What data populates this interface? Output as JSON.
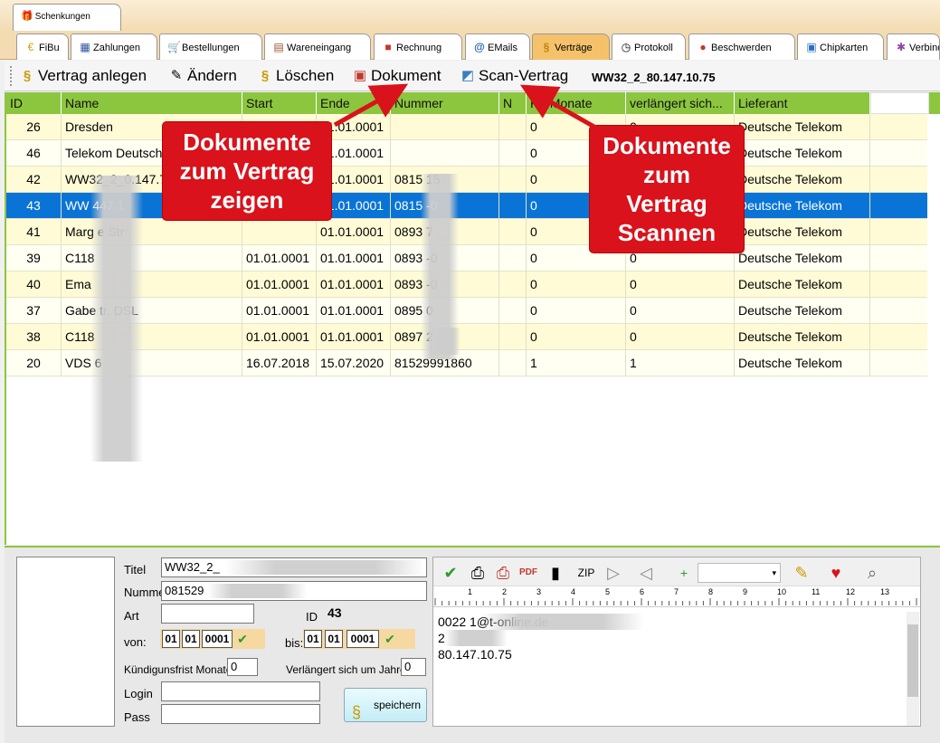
{
  "top_tab": {
    "label": "Schenkungen"
  },
  "module_tabs": [
    {
      "label": "FiBu",
      "icon": "euro-icon"
    },
    {
      "label": "Zahlungen",
      "icon": "calculator-icon"
    },
    {
      "label": "Bestellungen",
      "icon": "cart-icon"
    },
    {
      "label": "Wareneingang",
      "icon": "dolly-icon"
    },
    {
      "label": "Rechnung",
      "icon": "invoice-icon"
    },
    {
      "label": "EMails",
      "icon": "at-icon"
    },
    {
      "label": "Verträge",
      "icon": "paragraph-icon"
    },
    {
      "label": "Protokoll",
      "icon": "clock-icon"
    },
    {
      "label": "Beschwerden",
      "icon": "complaint-icon"
    },
    {
      "label": "Chipkarten",
      "icon": "card-icon"
    },
    {
      "label": "Verbind",
      "icon": "network-icon"
    }
  ],
  "toolbar": {
    "create": "Vertrag anlegen",
    "edit": "Ändern",
    "delete": "Löschen",
    "document": "Dokument",
    "scan": "Scan-Vertrag",
    "info": "WW32_2_80.147.10.75"
  },
  "grid": {
    "columns": [
      "ID",
      "Name",
      "Start",
      "Ende",
      "Nummer",
      "N",
      "KF Monate",
      "verlängert  sich...",
      "Lieferant"
    ],
    "rows": [
      {
        "id": "26",
        "name": "Dresden",
        "start": "",
        "ende": "01.01.0001",
        "nummer": "",
        "n": "",
        "kf": "0",
        "verl": "0",
        "lieferant": "Deutsche Telekom"
      },
      {
        "id": "46",
        "name": "Telekom Deutschla",
        "start": "",
        "ende": "01.01.0001",
        "nummer": "",
        "n": "",
        "kf": "0",
        "verl": "0",
        "lieferant": "Deutsche Telekom"
      },
      {
        "id": "42",
        "name": "WW32_2_0.147.7.2",
        "start": "",
        "ende": "01.01.0001",
        "nummer": "0815  15",
        "n": "",
        "kf": "0",
        "verl": "0",
        "lieferant": "Deutsche Telekom"
      },
      {
        "id": "43",
        "name": "WW  447.1",
        "start": "",
        "ende": "01.01.0001",
        "nummer": "0815  -0",
        "n": "",
        "kf": "0",
        "verl": "0",
        "lieferant": "Deutsche Telekom"
      },
      {
        "id": "41",
        "name": "Marg  e Str",
        "start": "",
        "ende": "01.01.0001",
        "nummer": "0893  7",
        "n": "",
        "kf": "0",
        "verl": "0",
        "lieferant": "Deutsche Telekom"
      },
      {
        "id": "39",
        "name": "C118",
        "start": "01.01.0001",
        "ende": "01.01.0001",
        "nummer": "0893  -0",
        "n": "",
        "kf": "0",
        "verl": "0",
        "lieferant": "Deutsche Telekom"
      },
      {
        "id": "40",
        "name": "Ema",
        "start": "01.01.0001",
        "ende": "01.01.0001",
        "nummer": "0893  -0",
        "n": "",
        "kf": "0",
        "verl": "0",
        "lieferant": "Deutsche Telekom"
      },
      {
        "id": "37",
        "name": "Gabe  tr. DSL",
        "start": "01.01.0001",
        "ende": "01.01.0001",
        "nummer": "0895  0",
        "n": "",
        "kf": "0",
        "verl": "0",
        "lieferant": "Deutsche Telekom"
      },
      {
        "id": "38",
        "name": "C118",
        "start": "01.01.0001",
        "ende": "01.01.0001",
        "nummer": "0897  2",
        "n": "",
        "kf": "0",
        "verl": "0",
        "lieferant": "Deutsche Telekom"
      },
      {
        "id": "20",
        "name": "VDS  6",
        "start": "16.07.2018",
        "ende": "15.07.2020",
        "nummer": "81529991860",
        "n": "",
        "kf": "1",
        "verl": "1",
        "lieferant": "Deutsche Telekom"
      }
    ]
  },
  "callouts": {
    "left": [
      "Dokumente",
      "zum Vertrag",
      "zeigen"
    ],
    "right": [
      "Dokumente",
      "zum",
      "Vertrag",
      "Scannen"
    ]
  },
  "detail": {
    "titel_label": "Titel",
    "titel_value": "WW32_2_",
    "nummer_label": "Numme",
    "nummer_value": "081529",
    "art_label": "Art",
    "art_value": "",
    "id_label": "ID",
    "id_value": "43",
    "von_label": "von:",
    "von_day": "01",
    "von_month": "01",
    "von_year": "0001",
    "bis_label": "bis:",
    "bis_day": "01",
    "bis_month": "01",
    "bis_year": "0001",
    "kuend_label": "Kündigunsfrist Monate",
    "kuend_value": "0",
    "verl_label": "Verlängert sich um Jahre",
    "verl_value": "0",
    "login_label": "Login",
    "login_value": "",
    "pass_label": "Pass",
    "pass_value": "",
    "save_label": "speichern",
    "editor_lines": [
      "0022  1@t-online.de",
      "2",
      "80.147.10.75"
    ],
    "ruler": [
      "1",
      "2",
      "3",
      "4",
      "5",
      "6",
      "7",
      "8",
      "9",
      "10",
      "11",
      "12",
      "13"
    ]
  }
}
